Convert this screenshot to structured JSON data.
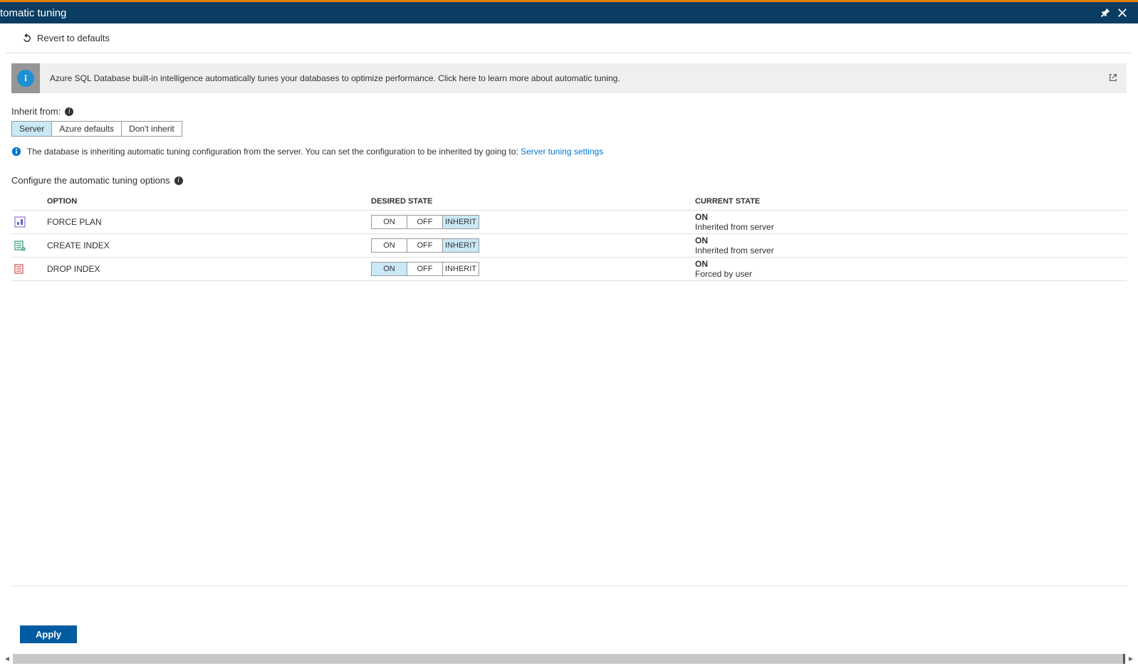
{
  "header": {
    "title": "tomatic tuning"
  },
  "toolbar": {
    "revert_label": "Revert to defaults"
  },
  "banner": {
    "text": "Azure SQL Database built-in intelligence automatically tunes your databases to optimize performance. Click here to learn more about automatic tuning."
  },
  "inherit": {
    "label": "Inherit from:",
    "options": [
      "Server",
      "Azure defaults",
      "Don't inherit"
    ],
    "selected_index": 0,
    "note_prefix": "The database is inheriting automatic tuning configuration from the server. You can set the configuration to be inherited by going to:",
    "note_link": "Server tuning settings"
  },
  "configure": {
    "label": "Configure the automatic tuning options",
    "columns": {
      "option": "OPTION",
      "desired": "DESIRED STATE",
      "current": "CURRENT STATE"
    },
    "state_labels": {
      "on": "ON",
      "off": "OFF",
      "inherit": "INHERIT"
    },
    "rows": [
      {
        "name": "FORCE PLAN",
        "icon": "force-plan-icon",
        "selected": "inherit",
        "current_state": "ON",
        "current_detail": "Inherited from server"
      },
      {
        "name": "CREATE INDEX",
        "icon": "create-index-icon",
        "selected": "inherit",
        "current_state": "ON",
        "current_detail": "Inherited from server"
      },
      {
        "name": "DROP INDEX",
        "icon": "drop-index-icon",
        "selected": "on",
        "current_state": "ON",
        "current_detail": "Forced by user"
      }
    ]
  },
  "footer": {
    "apply_label": "Apply"
  }
}
